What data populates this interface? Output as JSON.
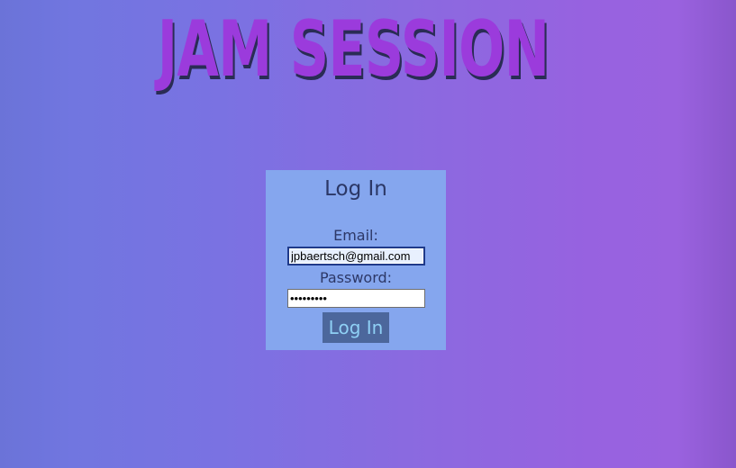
{
  "app": {
    "title": "JAM SESSION"
  },
  "login": {
    "heading": "Log In",
    "email_label": "Email:",
    "email_value": "jpbaertsch@gmail.com",
    "password_label": "Password:",
    "password_value": "•••••••••",
    "submit_label": "Log In"
  },
  "colors": {
    "title": "#9b3bdc",
    "title_shadow": "#2a2c55",
    "panel_background": "#85a6ee",
    "button_background": "#4c679c",
    "button_text": "#8fd0f5",
    "gradient_left": "#6b73d8",
    "gradient_right": "#9a62df"
  }
}
